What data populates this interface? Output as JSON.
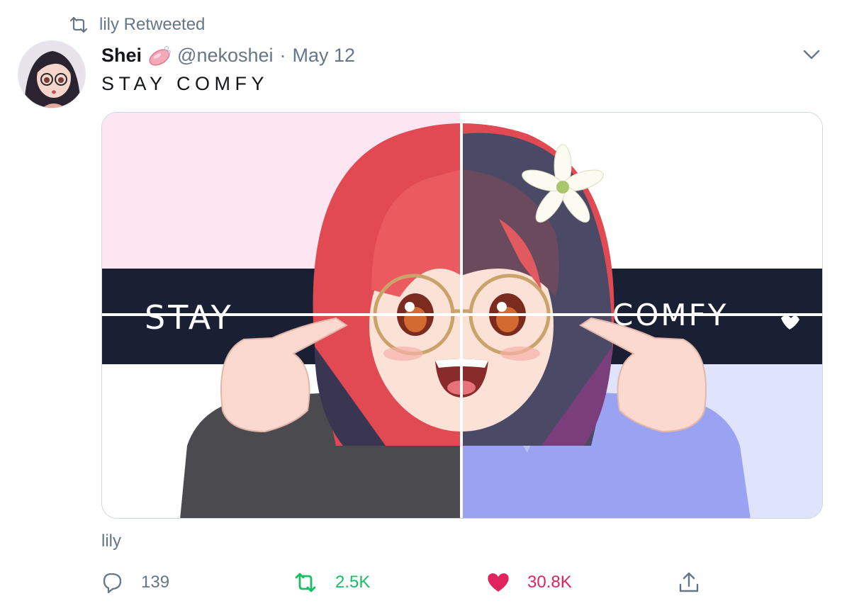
{
  "retweet_context": {
    "text": "lily Retweeted",
    "icon": "retweet-icon"
  },
  "tweet": {
    "author": {
      "display_name": "Shei",
      "handle": "@nekoshei",
      "name_emoji": "soap-icon"
    },
    "separator": "·",
    "date": "May 12",
    "text": "STAY COMFY",
    "media": {
      "image_text_left": "STAY",
      "image_text_right": "COMFY"
    },
    "source_label": "lily"
  },
  "actions": {
    "replies": "139",
    "retweets": "2.5K",
    "likes": "30.8K"
  },
  "colors": {
    "muted": "#657786",
    "retweet_green": "#17bf63",
    "like_red": "#e0245e",
    "text": "#14171a",
    "banner_navy": "#1a2033"
  }
}
